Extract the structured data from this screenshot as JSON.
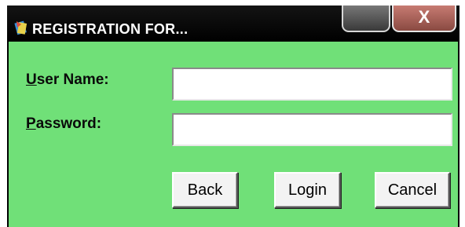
{
  "window": {
    "title": "REGISTRATION  FOR...",
    "icon": "app-icon",
    "controls": {
      "minimize_icon": "minimize-icon",
      "close_label": "X"
    }
  },
  "form": {
    "username": {
      "label_mnemonic": "U",
      "label_rest": "ser Name:",
      "value": ""
    },
    "password": {
      "label_mnemonic": "P",
      "label_rest": "assword:",
      "value": ""
    }
  },
  "buttons": {
    "back": "Back",
    "login": "Login",
    "cancel": "Cancel"
  },
  "colors": {
    "client_bg": "#70e078",
    "titlebar_bg": "#000000",
    "close_button": "#b36459"
  }
}
